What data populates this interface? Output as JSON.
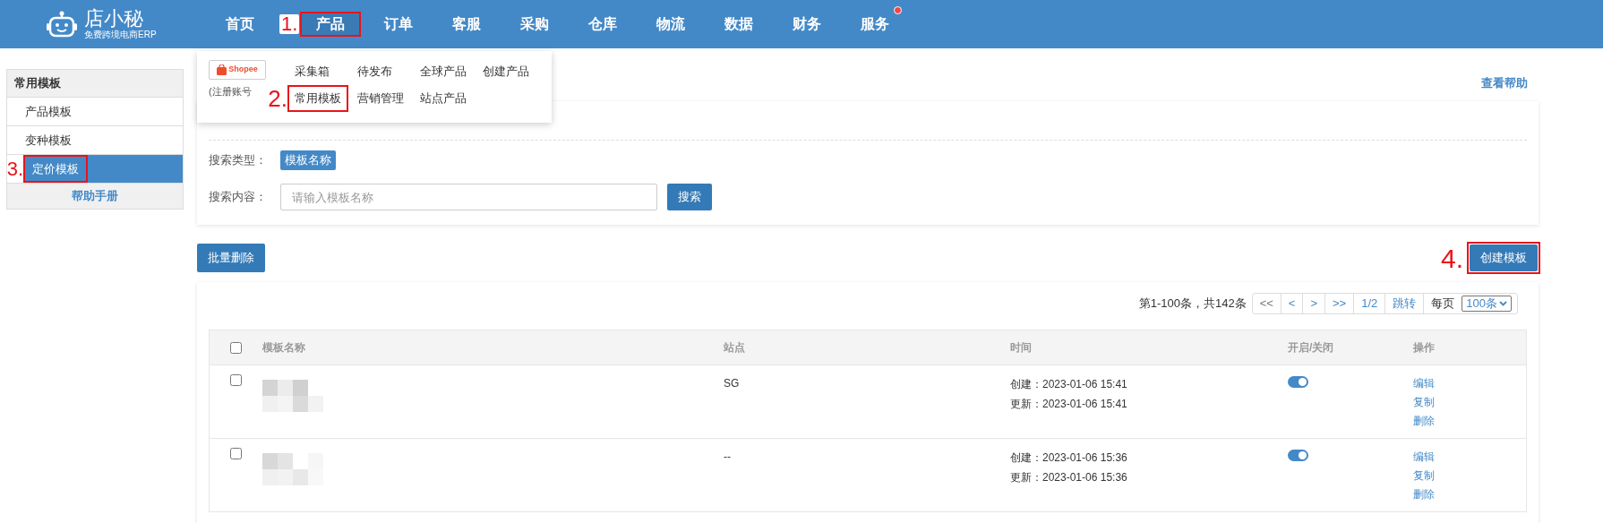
{
  "logo": {
    "name": "店小秘",
    "tagline": "免费跨境电商ERP"
  },
  "nav": [
    {
      "label": "首页",
      "selected": false,
      "badge": false
    },
    {
      "label": "产品",
      "selected": true,
      "badge": false,
      "marker": "1."
    },
    {
      "label": "订单",
      "selected": false,
      "badge": false
    },
    {
      "label": "客服",
      "selected": false,
      "badge": false
    },
    {
      "label": "采购",
      "selected": false,
      "badge": false
    },
    {
      "label": "仓库",
      "selected": false,
      "badge": false
    },
    {
      "label": "物流",
      "selected": false,
      "badge": false
    },
    {
      "label": "数据",
      "selected": false,
      "badge": false
    },
    {
      "label": "财务",
      "selected": false,
      "badge": false
    },
    {
      "label": "服务",
      "selected": false,
      "badge": true
    }
  ],
  "dropdown": {
    "shop_logo": "Shopee",
    "shop_note": "(注册账号",
    "rows": [
      [
        {
          "label": "采集箱",
          "selected": false
        },
        {
          "label": "待发布",
          "selected": false
        },
        {
          "label": "全球产品",
          "selected": false
        },
        {
          "label": "创建产品",
          "selected": false
        }
      ],
      [
        {
          "label": "常用模板",
          "selected": true,
          "marker": "2."
        },
        {
          "label": "营销管理",
          "selected": false
        },
        {
          "label": "站点产品",
          "selected": false
        }
      ]
    ]
  },
  "sidebar": {
    "title": "常用模板",
    "items": [
      {
        "label": "产品模板",
        "selected": false
      },
      {
        "label": "变种模板",
        "selected": false
      },
      {
        "label": "定价模板",
        "selected": true,
        "marker": "3."
      }
    ],
    "help": "帮助手册"
  },
  "help_link": "查看帮助",
  "filters": {
    "search_type": {
      "label": "搜索类型：",
      "options": [
        {
          "label": "模板名称",
          "selected": true
        }
      ]
    },
    "search": {
      "label": "搜索内容：",
      "placeholder": "请输入模板名称",
      "button": "搜索"
    }
  },
  "bulk_delete": "批量删除",
  "create_button": {
    "label": "创建模板",
    "marker": "4."
  },
  "pagination": {
    "summary": "第1-100条，共142条",
    "buttons": [
      "<<",
      "<",
      ">",
      ">>",
      "1/2",
      "跳转"
    ],
    "per_page_label": "每页",
    "per_page": "100条"
  },
  "table": {
    "all_checked": false,
    "columns": [
      "模板名称",
      "站点",
      "时间",
      "开启/关闭",
      "操作"
    ],
    "rows": [
      {
        "checked": false,
        "site": "SG",
        "created": "创建：2023-01-06 15:41",
        "updated": "更新：2023-01-06 15:41",
        "on": true,
        "actions": [
          "编辑",
          "复制",
          "删除"
        ]
      },
      {
        "checked": false,
        "site": "--",
        "created": "创建：2023-01-06 15:36",
        "updated": "更新：2023-01-06 15:36",
        "on": true,
        "actions": [
          "编辑",
          "复制",
          "删除"
        ]
      }
    ]
  }
}
